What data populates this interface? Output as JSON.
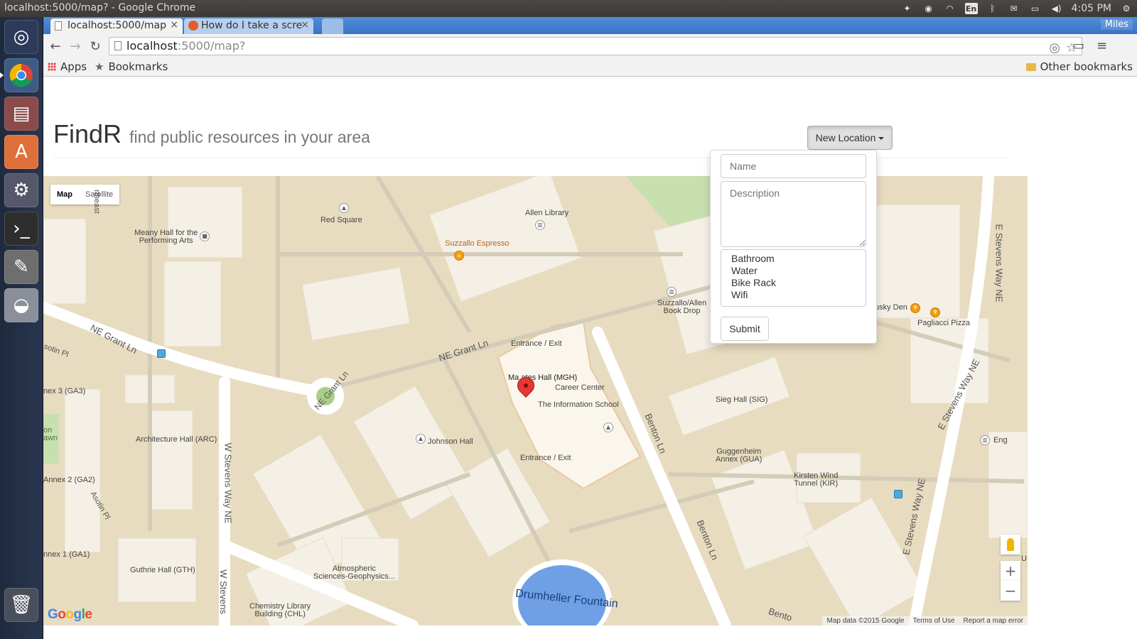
{
  "os_panel": {
    "window_title": "localhost:5000/map? - Google Chrome",
    "lang": "En",
    "time": "4:05 PM"
  },
  "launcher": {
    "items": [
      "ubuntu-dash-icon",
      "chrome-icon",
      "files-icon",
      "software-center-icon",
      "system-settings-icon",
      "terminal-icon",
      "text-editor-icon",
      "disk-icon",
      "trash-icon"
    ]
  },
  "browser": {
    "tabs": [
      {
        "label": "localhost:5000/map",
        "active": true
      },
      {
        "label": "How do I take a scre",
        "active": false
      }
    ],
    "profile": "Miles",
    "url_host": "localhost",
    "url_path": ":5000/map?",
    "bookmarks": {
      "apps": "Apps",
      "bookmarks": "Bookmarks",
      "other": "Other bookmarks"
    }
  },
  "page": {
    "app_name": "FindR",
    "tagline": "find public resources in your area",
    "new_location_button": "New Location"
  },
  "form": {
    "name_placeholder": "Name",
    "description_placeholder": "Description",
    "options": [
      "Bathroom",
      "Water",
      "Bike Rack",
      "Wifi"
    ],
    "submit_label": "Submit"
  },
  "map": {
    "type_map": "Map",
    "type_satellite": "Satellite",
    "labels": {
      "meany_hall": "Meany Hall for the\nPerforming Arts",
      "red_square": "Red Square",
      "allen_library": "Allen Library",
      "suzzallo": "Suzzallo Espresso",
      "book_drop": "Suzzallo/Allen\nBook Drop",
      "husky_den": "usky Den",
      "pagliacci": "Pagliacci Pizza",
      "entrance_top": "Entrance / Exit",
      "mgh": "Ma      ates Hall (MGH)",
      "career_center": "Career Center",
      "ischool": "The Information School",
      "entrance_bottom": "Entrance / Exit",
      "sieg_hall": "Sieg Hall (SIG)",
      "guggenheim": "Guggenheim\nAnnex (GUA)",
      "kirsten": "Kirsten Wind\nTunnel (KIR)",
      "johnson_hall": "Johnson Hall",
      "architecture_hall": "Architecture Hall (ARC)",
      "annex_3": "nex 3 (GA3)",
      "annex_2": "Annex 2 (GA2)",
      "annex_1": "nnex 1 (GA1)",
      "guthrie": "Guthrie Hall (GTH)",
      "atmospheric": "Atmospheric\nSciences-Geophysics...",
      "chemistry": "Chemistry Library\nBuilding (CHL)",
      "fountain": "Drumheller Fountain",
      "eng": "Eng",
      "lawn": "on\nawn",
      "u_label": "U"
    },
    "streets": {
      "ne_grant_ln_left": "NE Grant Ln",
      "ne_grant_ln_mid": "NE Grant Ln",
      "ne_grant_ln_circle": "NE Grant Ln",
      "w_stevens_1": "W Stevens Way NE",
      "w_stevens_2": "W Stevens",
      "benton_1": "Benton Ln",
      "benton_2": "Benton Ln",
      "benton_3": "Bento",
      "e_stevens_1": "E Stevens Way NE",
      "e_stevens_2": "E Stevens Way NE",
      "e_stevens_3": "E Stevens Way NE",
      "asotin_1": "Asotin Pl",
      "asotin_2": "sotin Pl",
      "northeast": "rtheast"
    },
    "zoom_in": "+",
    "zoom_out": "−",
    "google_logo": "Google",
    "attribution": {
      "data": "Map data ©2015 Google",
      "terms": "Terms of Use",
      "report": "Report a map error"
    }
  },
  "colors": {
    "map_land": "#e8dcc0",
    "map_road": "#ffffff",
    "map_building": "#f5f0e6",
    "map_park": "#c8dfb0",
    "map_water": "#6fa0e6",
    "chrome_tab_bar": "#3a73c4",
    "marker": "#e53935"
  }
}
